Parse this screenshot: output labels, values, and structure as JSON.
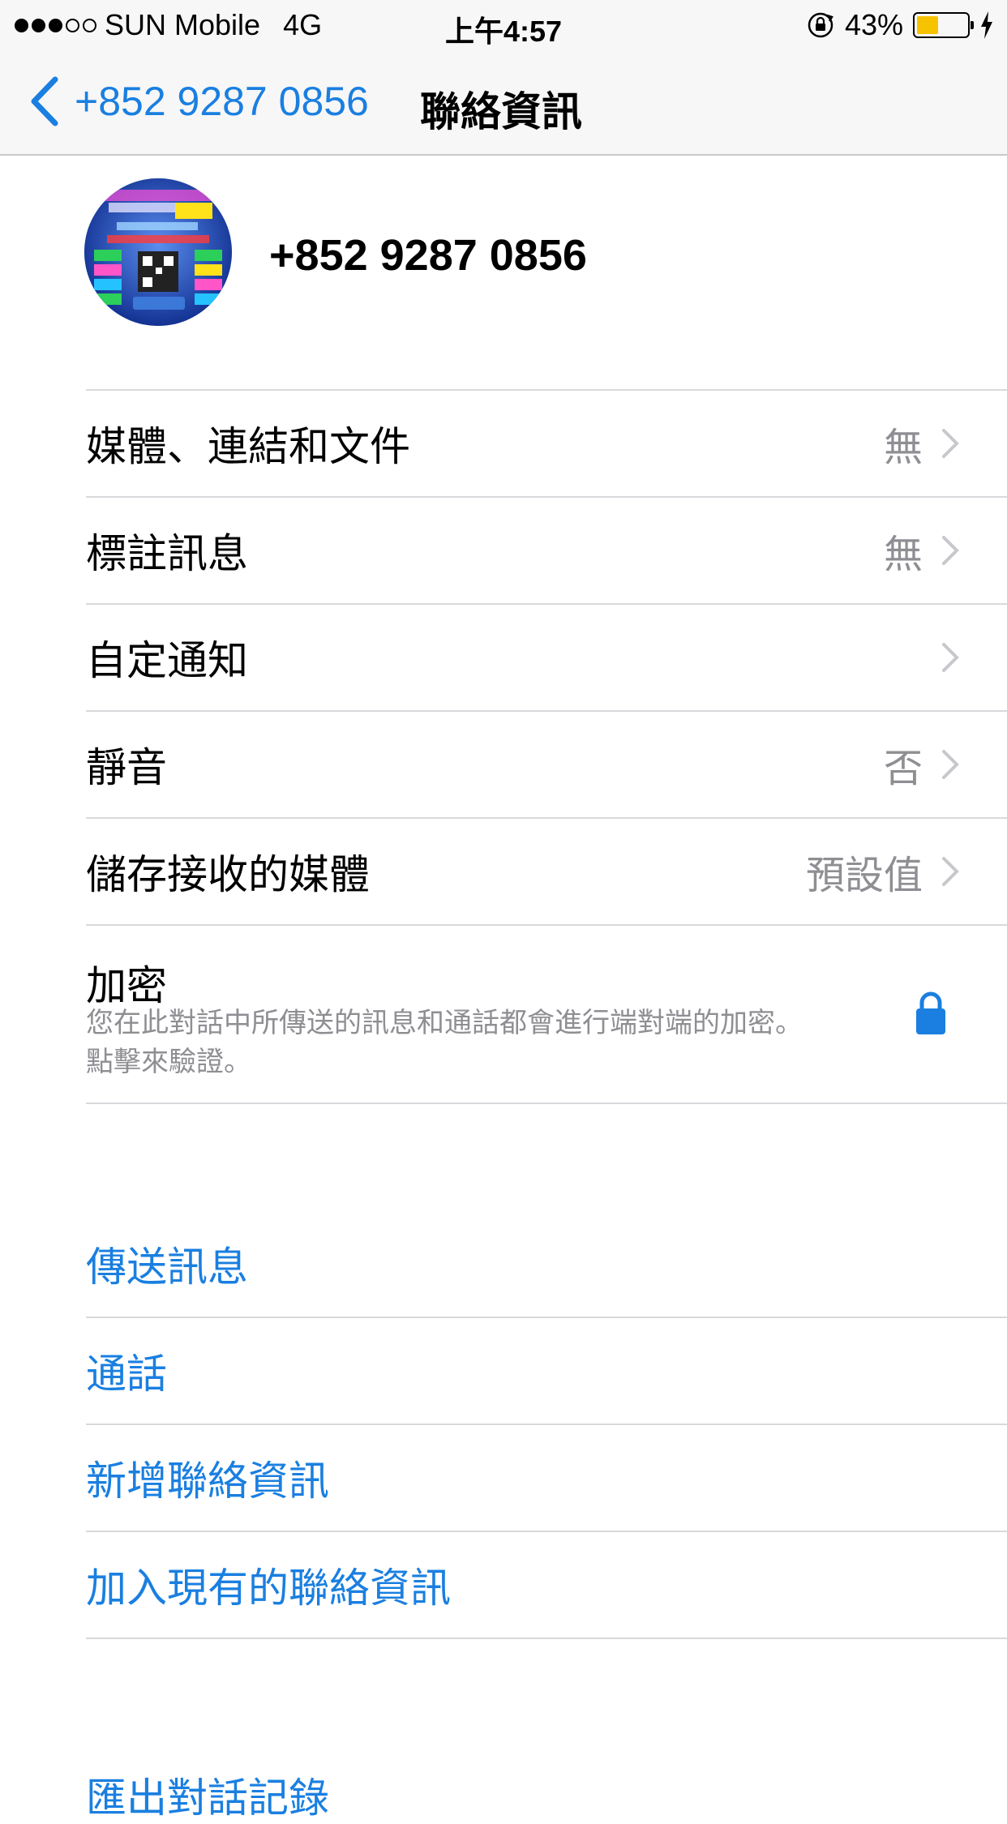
{
  "status_bar": {
    "carrier": "SUN Mobile",
    "network": "4G",
    "time": "上午4:57",
    "battery_percent": "43%",
    "battery_level": 0.43,
    "signal_bars_filled": 3,
    "signal_bars_total": 5
  },
  "nav": {
    "back_label": "+852 9287 0856",
    "title": "聯絡資訊"
  },
  "profile": {
    "name": "+852 9287 0856",
    "avatar_icon": "recruitment-poster-avatar"
  },
  "settings": [
    {
      "label": "媒體、連結和文件",
      "value": "無"
    },
    {
      "label": "標註訊息",
      "value": "無"
    },
    {
      "label": "自定通知",
      "value": ""
    },
    {
      "label": "靜音",
      "value": "否"
    },
    {
      "label": "儲存接收的媒體",
      "value": "預設值"
    }
  ],
  "encryption": {
    "title": "加密",
    "description": "您在此對話中所傳送的訊息和通話都會進行端對端的加密。點擊來驗證。",
    "icon": "lock-icon"
  },
  "actions": [
    {
      "label": "傳送訊息"
    },
    {
      "label": "通話"
    },
    {
      "label": "新增聯絡資訊"
    },
    {
      "label": "加入現有的聯絡資訊"
    }
  ],
  "partial_action": "匯出對話記錄",
  "colors": {
    "accent": "#1a7fe0",
    "secondary_text": "#8e8e93",
    "battery": "#f7c300"
  }
}
